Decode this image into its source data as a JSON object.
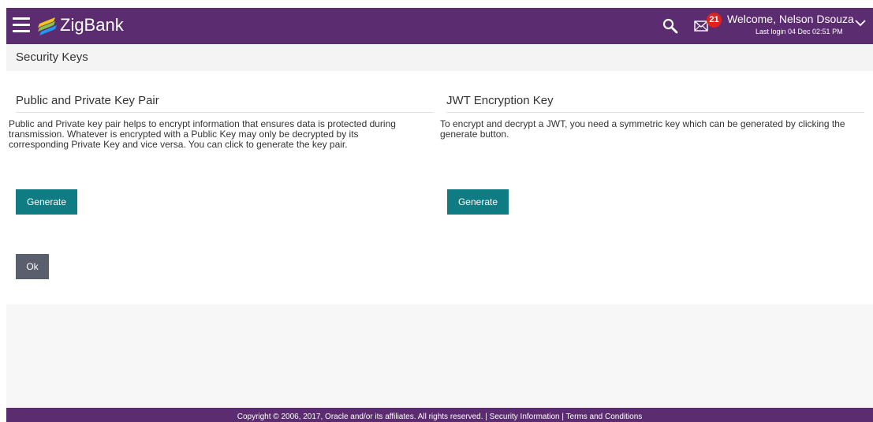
{
  "header": {
    "brand": "ZigBank",
    "notification_count": "21",
    "welcome": "Welcome, Nelson Dsouza",
    "last_login": "Last login 04 Dec 02:51 PM",
    "colors": {
      "bar": "#5b2c6f",
      "badge": "#e02020"
    },
    "icons": [
      "hamburger-menu-icon",
      "zigbank-logo-icon",
      "search-icon",
      "mail-icon",
      "chevron-down-icon"
    ]
  },
  "page": {
    "title": "Security Keys"
  },
  "key_pair": {
    "title": "Public and Private Key Pair",
    "description_lines": [
      "Public and Private key pair helps to encrypt information that ensures data is protected during",
      "transmission. Whatever is encrypted with a Public Key may only be decrypted by its",
      "corresponding Private Key and vice versa. You can click to generate the key pair."
    ],
    "button": "Generate"
  },
  "jwt": {
    "title": "JWT Encryption Key",
    "description_lines": [
      "To encrypt and decrypt a JWT, you need a symmetric key which can be generated by clicking the",
      "generate button."
    ],
    "button": "Generate"
  },
  "actions": {
    "ok": "Ok"
  },
  "footer": {
    "copyright": "Copyright © 2006, 2017, Oracle and/or its affiliates. All rights reserved. | Security Information | Terms and Conditions"
  },
  "colors": {
    "primary_button": "#0f7b82",
    "ok_button": "#5a5f6e"
  }
}
